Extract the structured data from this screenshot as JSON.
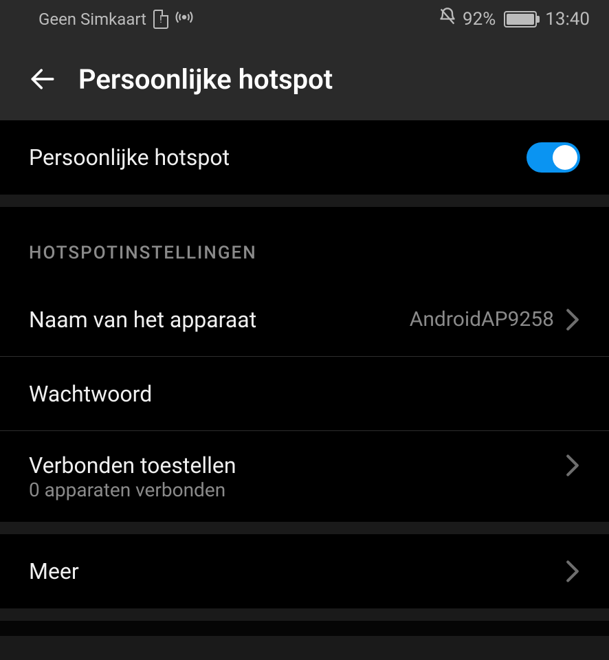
{
  "status": {
    "sim_text": "Geen Simkaart",
    "battery_percent": "92%",
    "time": "13:40"
  },
  "header": {
    "title": "Persoonlijke hotspot"
  },
  "toggle_row": {
    "label": "Persoonlijke hotspot",
    "enabled": true
  },
  "section_header": "HOTSPOTINSTELLINGEN",
  "rows": {
    "device_name": {
      "label": "Naam van het apparaat",
      "value": "AndroidAP9258"
    },
    "password": {
      "label": "Wachtwoord"
    },
    "connected": {
      "label": "Verbonden toestellen",
      "sub": "0 apparaten verbonden"
    },
    "more": {
      "label": "Meer"
    }
  }
}
